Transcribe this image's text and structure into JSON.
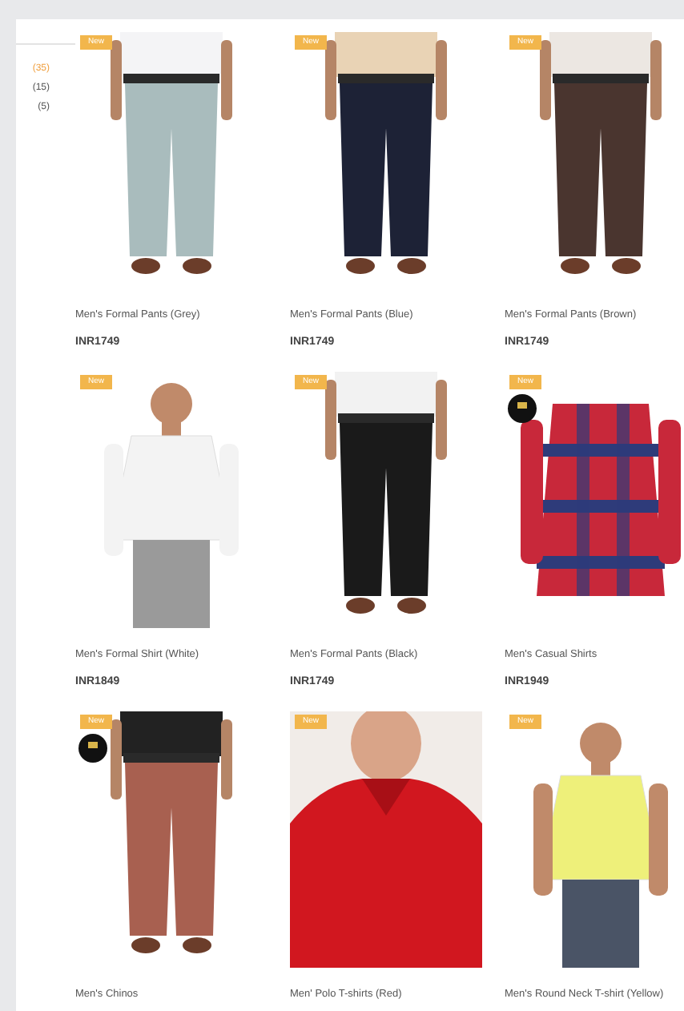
{
  "filters": [
    {
      "count": "(35)",
      "selected": true
    },
    {
      "count": "(15)",
      "selected": false
    },
    {
      "count": "(5)",
      "selected": false
    }
  ],
  "products": [
    {
      "badge": "New",
      "logo_badge": false,
      "name": "Men's Formal Pants (Grey)",
      "price": "INR1749"
    },
    {
      "badge": "New",
      "logo_badge": false,
      "name": "Men's Formal Pants (Blue)",
      "price": "INR1749"
    },
    {
      "badge": "New",
      "logo_badge": false,
      "name": "Men's Formal Pants (Brown)",
      "price": "INR1749"
    },
    {
      "badge": "New",
      "logo_badge": false,
      "name": "Men's Formal Shirt (White)",
      "price": "INR1849"
    },
    {
      "badge": "New",
      "logo_badge": false,
      "name": "Men's Formal Pants (Black)",
      "price": "INR1749"
    },
    {
      "badge": "New",
      "logo_badge": true,
      "name": "Men's Casual Shirts",
      "price": "INR1949"
    },
    {
      "badge": "New",
      "logo_badge": true,
      "name": "Men's Chinos"
    },
    {
      "badge": "New",
      "logo_badge": false,
      "name": "Men' Polo T-shirts (Red)"
    },
    {
      "badge": "New",
      "logo_badge": false,
      "name": "Men's Round Neck T-shirt (Yellow)"
    }
  ]
}
